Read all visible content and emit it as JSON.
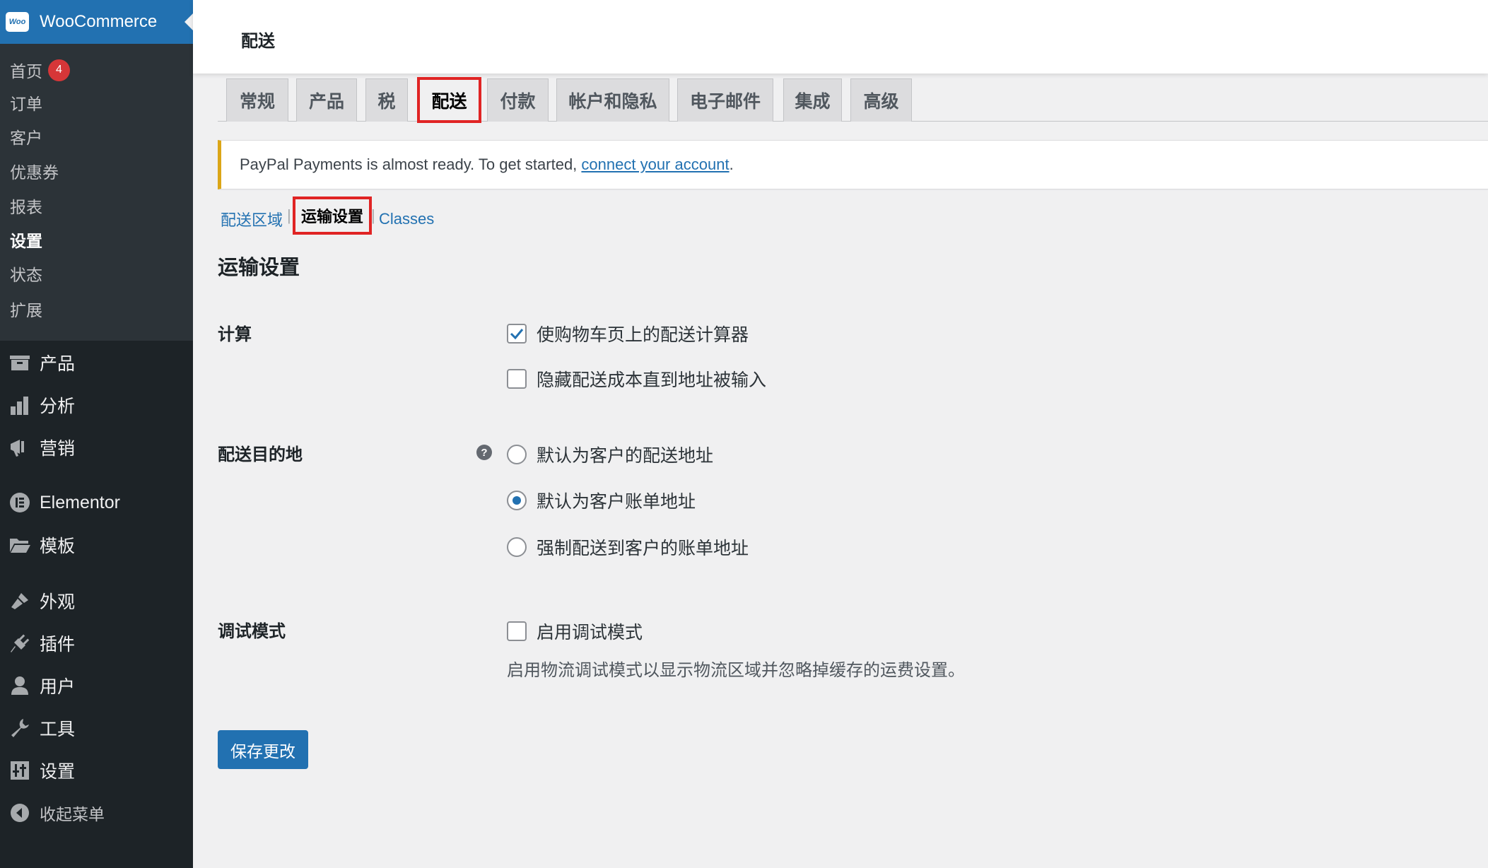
{
  "sidebar": {
    "brand": "WooCommerce",
    "brand_logo_text": "Woo",
    "submenu": [
      {
        "label": "首页",
        "badge": "4"
      },
      {
        "label": "订单"
      },
      {
        "label": "客户"
      },
      {
        "label": "优惠券"
      },
      {
        "label": "报表"
      },
      {
        "label": "设置",
        "current": true
      },
      {
        "label": "状态"
      },
      {
        "label": "扩展"
      }
    ],
    "menu": [
      {
        "label": "产品",
        "icon": "archive-icon"
      },
      {
        "label": "分析",
        "icon": "bar-chart-icon"
      },
      {
        "label": "营销",
        "icon": "megaphone-icon"
      },
      {
        "label": "Elementor",
        "icon": "elementor-icon"
      },
      {
        "label": "模板",
        "icon": "folder-icon"
      },
      {
        "label": "外观",
        "icon": "brush-icon"
      },
      {
        "label": "插件",
        "icon": "plugin-icon"
      },
      {
        "label": "用户",
        "icon": "user-icon"
      },
      {
        "label": "工具",
        "icon": "wrench-icon"
      },
      {
        "label": "设置",
        "icon": "settings-icon"
      },
      {
        "label": "收起菜单",
        "icon": "collapse-arrow-icon"
      }
    ]
  },
  "header": {
    "title": "配送"
  },
  "tabs": [
    {
      "label": "常规"
    },
    {
      "label": "产品"
    },
    {
      "label": "税"
    },
    {
      "label": "配送",
      "active": true
    },
    {
      "label": "付款"
    },
    {
      "label": "帐户和隐私"
    },
    {
      "label": "电子邮件"
    },
    {
      "label": "集成"
    },
    {
      "label": "高级"
    }
  ],
  "notice": {
    "text": "PayPal Payments is almost ready. To get started, ",
    "link": "connect your account",
    "end": "."
  },
  "subsections": {
    "zones": "配送区域",
    "options": "运输设置",
    "classes": "Classes",
    "separator": "|"
  },
  "section_title": "运输设置",
  "settings": {
    "calc_label": "计算",
    "calc_opt1": "使购物车页上的配送计算器",
    "calc_opt2": "隐藏配送成本直到地址被输入",
    "dest_label": "配送目的地",
    "help_glyph": "?",
    "dest_opt1": "默认为客户的配送地址",
    "dest_opt2": "默认为客户账单地址",
    "dest_opt3": "强制配送到客户的账单地址",
    "debug_label": "调试模式",
    "debug_opt": "启用调试模式",
    "debug_desc": "启用物流调试模式以显示物流区域并忽略掉缓存的运费设置。"
  },
  "save_button": "保存更改",
  "colors": {
    "accent": "#2271b1",
    "highlight": "#e02424",
    "sidebar": "#1d2327"
  }
}
